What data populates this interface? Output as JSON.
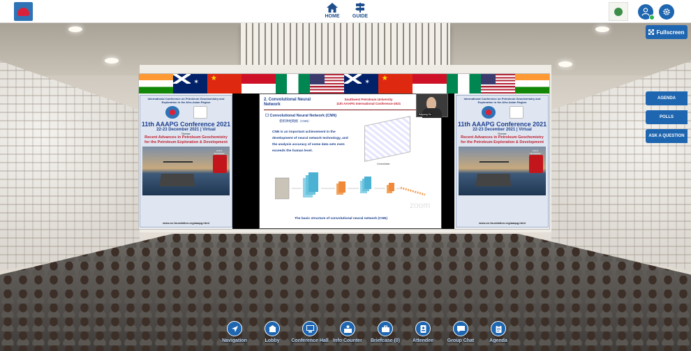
{
  "topbar": {
    "nav": [
      {
        "label": "HOME",
        "icon": "home-icon"
      },
      {
        "label": "GUIDE",
        "icon": "signpost-icon"
      }
    ],
    "user_icon": "user-icon",
    "settings_icon": "gear-icon"
  },
  "fullscreen_label": "Fullscreen",
  "side_buttons": [
    {
      "label": "AGENDA"
    },
    {
      "label": "POLLS"
    },
    {
      "label": "ASK A QUESTION"
    }
  ],
  "poster": {
    "header": "International Conference on Petroleum Geochemistry and Exploration in the Afro-Asian Region",
    "title": "11th AAAPG Conference 2021",
    "date": "22-23 December 2021 | Virtual",
    "theme_label": "Theme:",
    "theme": "Recent Advances in Petroleum Geochemistry for the Petroleum Exploration & Development",
    "sponsor": "GOLD SPONSOR",
    "sponsor_logo": "ONGC",
    "url": "www.oe-foundation.org/aaapg.html"
  },
  "slide": {
    "section": "2. Convolutional Neural Network",
    "university": "Southwest Petroleum University",
    "conference": "11th AAAPG International Conference-2021",
    "heading": "Convolutional Neural Network (CNN)",
    "heading_cn": "卷积神经网络（CNN）",
    "body": "CNN is an important achievement in the development of neural network technology, and the analysis accuracy of some data sets even exceeds the human level.",
    "conv_caption": "Convolution",
    "caption": "The basic structure of convolutional neural network (CNN)"
  },
  "speaker": {
    "name": "Kaiyang Su"
  },
  "zoom_watermark": "zoom",
  "bottom_nav": [
    {
      "label": "Navigation",
      "icon": "compass-icon"
    },
    {
      "label": "Lobby",
      "icon": "lobby-icon"
    },
    {
      "label": "Conference Hall",
      "icon": "presentation-icon"
    },
    {
      "label": "Info Counter",
      "icon": "info-counter-icon"
    },
    {
      "label": "Briefcase (0)",
      "icon": "briefcase-icon"
    },
    {
      "label": "Attendee",
      "icon": "attendee-icon"
    },
    {
      "label": "Group Chat",
      "icon": "chat-icon"
    },
    {
      "label": "Agenda",
      "icon": "clipboard-icon"
    }
  ],
  "colors": {
    "accent": "#1f66b0",
    "nav_text": "#1f4e8c",
    "poster_red": "#c01e2e"
  }
}
